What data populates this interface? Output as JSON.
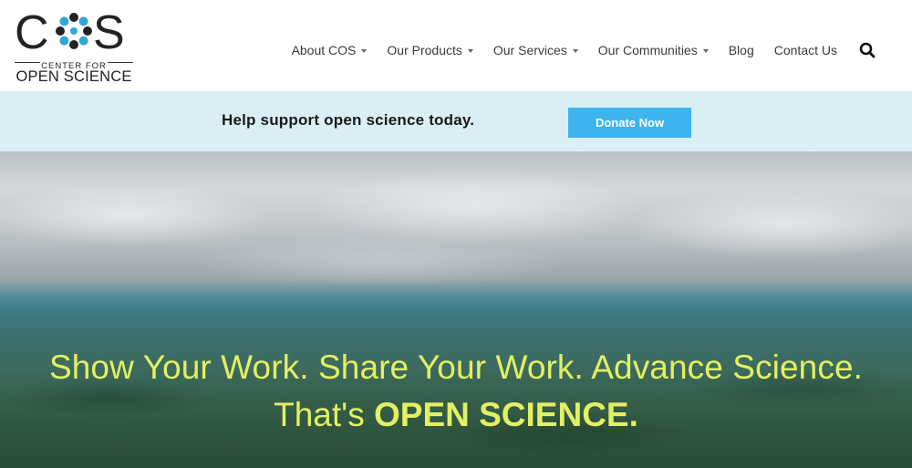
{
  "logo": {
    "mark_text_left": "C",
    "mark_text_right": "S",
    "line_small": "CENTER FOR",
    "line_big": "OPEN SCIENCE"
  },
  "nav": {
    "items": [
      {
        "label": "About COS",
        "has_dropdown": true
      },
      {
        "label": "Our Products",
        "has_dropdown": true
      },
      {
        "label": "Our Services",
        "has_dropdown": true
      },
      {
        "label": "Our Communities",
        "has_dropdown": true
      },
      {
        "label": "Blog",
        "has_dropdown": false
      },
      {
        "label": "Contact Us",
        "has_dropdown": false
      }
    ],
    "search_icon": "search-icon"
  },
  "donate": {
    "message": "Help support open science today.",
    "button_label": "Donate Now"
  },
  "hero": {
    "line1": "Show Your Work. Share Your Work. Advance Science.",
    "line2_prefix": "That's ",
    "line2_bold": "OPEN SCIENCE."
  },
  "colors": {
    "donate_band_bg": "#d9eff3",
    "donate_button_bg": "#3db4ee",
    "hero_text": "#e3f062",
    "logo_dark": "#222222",
    "logo_dot_blue": "#2fa7d8"
  }
}
